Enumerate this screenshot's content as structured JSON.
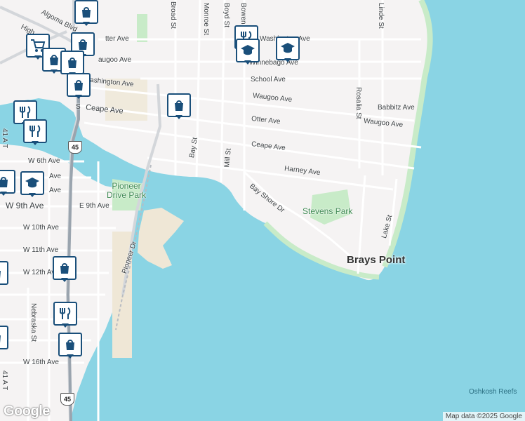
{
  "map": {
    "streets": [
      "Washington Ave",
      "Winnebago Ave",
      "School Ave",
      "Waugoo Ave",
      "Waugoo Ave",
      "Otter Ave",
      "Ceape Ave",
      "Harney Ave",
      "Babbitz Ave",
      "W 6th Ave",
      "W 9th Ave",
      "E 9th Ave",
      "W 10th Ave",
      "W 11th Ave",
      "W 12th Ave",
      "W 16th Ave",
      "Ave",
      "Ave",
      "Bay St",
      "Mill St",
      "Monroe St",
      "Boyd St",
      "Bowen St",
      "Linde St",
      "Rosalia St",
      "Lake St",
      "Nebraska St",
      "Pioneer Dr",
      "Bay Shore Dr",
      "Broad St",
      "Algoma Blvd",
      "High",
      "tter Ave",
      "ashington Ave",
      "augoo Ave",
      "S",
      "Ave",
      "Ave"
    ],
    "parks": [
      "Pioneer Drive Park",
      "Stevens Park"
    ],
    "places": [
      "Brays Point"
    ],
    "water": [
      "Oshkosh Reefs"
    ],
    "route_shield": "45",
    "poi_icons": [
      "shopping-bag-icon",
      "shopping-cart-icon",
      "restaurant-icon",
      "school-icon"
    ]
  },
  "attribution": "Map data ©2025 Google",
  "logo": "Google"
}
